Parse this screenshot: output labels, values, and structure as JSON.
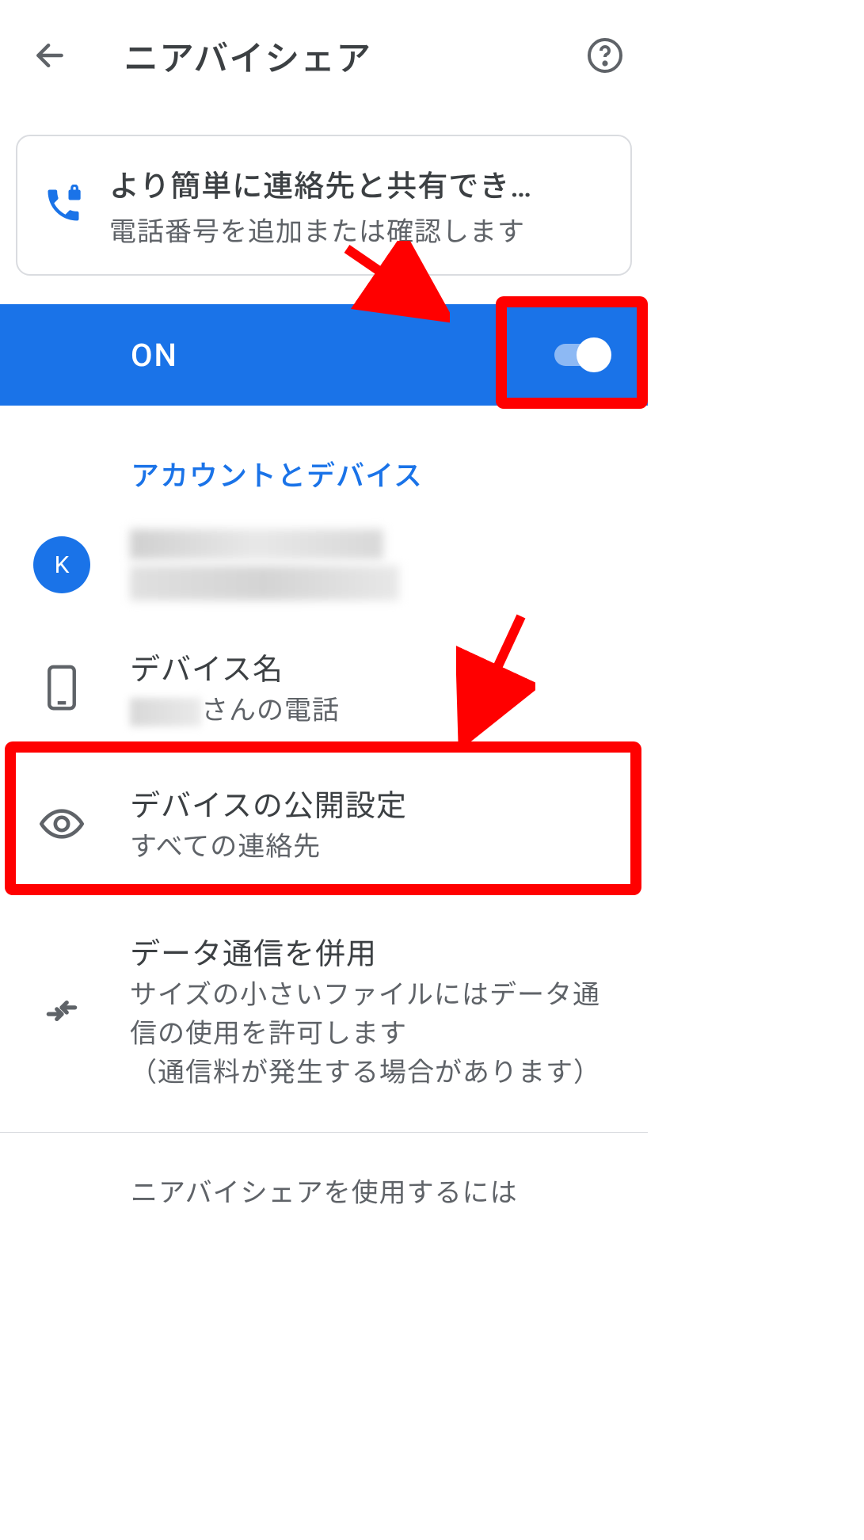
{
  "header": {
    "title": "ニアバイシェア"
  },
  "info_card": {
    "title": "より簡単に連絡先と共有でき…",
    "subtitle": "電話番号を追加または確認します"
  },
  "toggle": {
    "label": "ON",
    "state": true
  },
  "section": {
    "header": "アカウントとデバイス"
  },
  "account": {
    "avatar_letter": "K"
  },
  "device": {
    "title": "デバイス名",
    "subtitle_suffix": "さんの電話"
  },
  "visibility": {
    "title": "デバイスの公開設定",
    "subtitle": "すべての連絡先"
  },
  "data_usage": {
    "title": "データ通信を併用",
    "subtitle": "サイズの小さいファイルにはデータ通信の使用を許可します\n（通信料が発生する場合があります）"
  },
  "bottom_hint": "ニアバイシェアを使用するには",
  "colors": {
    "primary": "#1a73e8",
    "highlight": "#ff0000"
  }
}
